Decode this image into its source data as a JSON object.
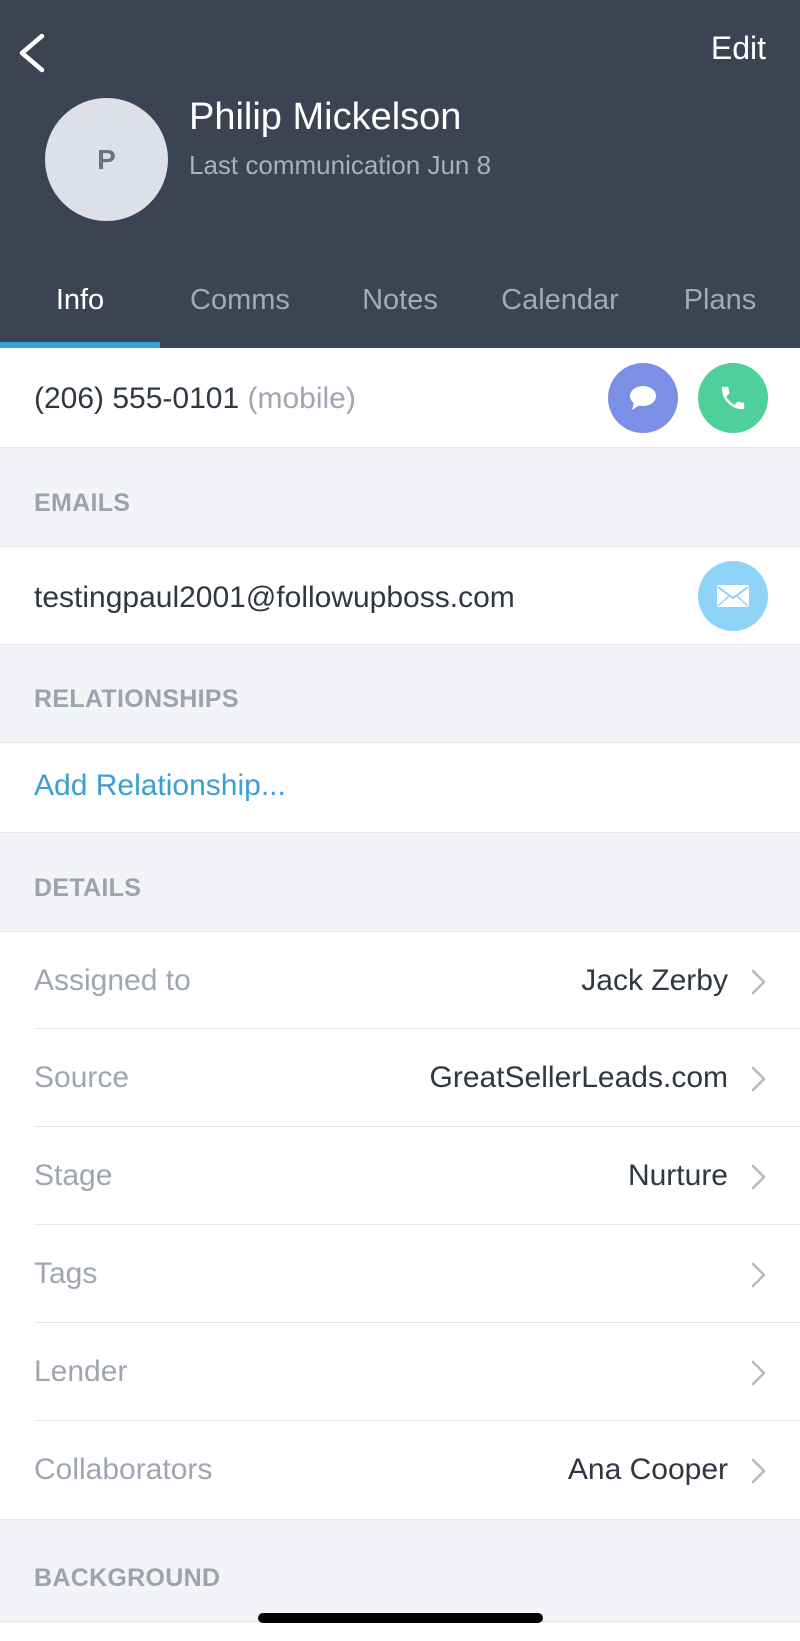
{
  "header": {
    "edit_label": "Edit",
    "avatar_initial": "P",
    "name": "Philip Mickelson",
    "last_communication": "Last communication Jun 8",
    "background_color": "#3a4452"
  },
  "tabs": [
    {
      "label": "Info",
      "active": true
    },
    {
      "label": "Comms",
      "active": false
    },
    {
      "label": "Notes",
      "active": false
    },
    {
      "label": "Calendar",
      "active": false
    },
    {
      "label": "Plans",
      "active": false
    }
  ],
  "phone": {
    "number": "(206) 555-0101",
    "type": "(mobile)",
    "message_icon": "chat-bubble-icon",
    "message_color": "#7b8fe6",
    "call_icon": "phone-icon",
    "call_color": "#4fcf9a"
  },
  "emails": {
    "heading": "EMAILS",
    "address": "testingpaul2001@followupboss.com",
    "email_icon": "envelope-icon",
    "email_color": "#8fd3f8"
  },
  "relationships": {
    "heading": "RELATIONSHIPS",
    "add_label": "Add Relationship..."
  },
  "details": {
    "heading": "DETAILS",
    "rows": [
      {
        "label": "Assigned to",
        "value": "Jack Zerby"
      },
      {
        "label": "Source",
        "value": "GreatSellerLeads.com"
      },
      {
        "label": "Stage",
        "value": "Nurture"
      },
      {
        "label": "Tags",
        "value": ""
      },
      {
        "label": "Lender",
        "value": ""
      },
      {
        "label": "Collaborators",
        "value": "Ana Cooper"
      }
    ]
  },
  "background": {
    "heading": "BACKGROUND"
  },
  "accent_color": "#3a9fd8"
}
